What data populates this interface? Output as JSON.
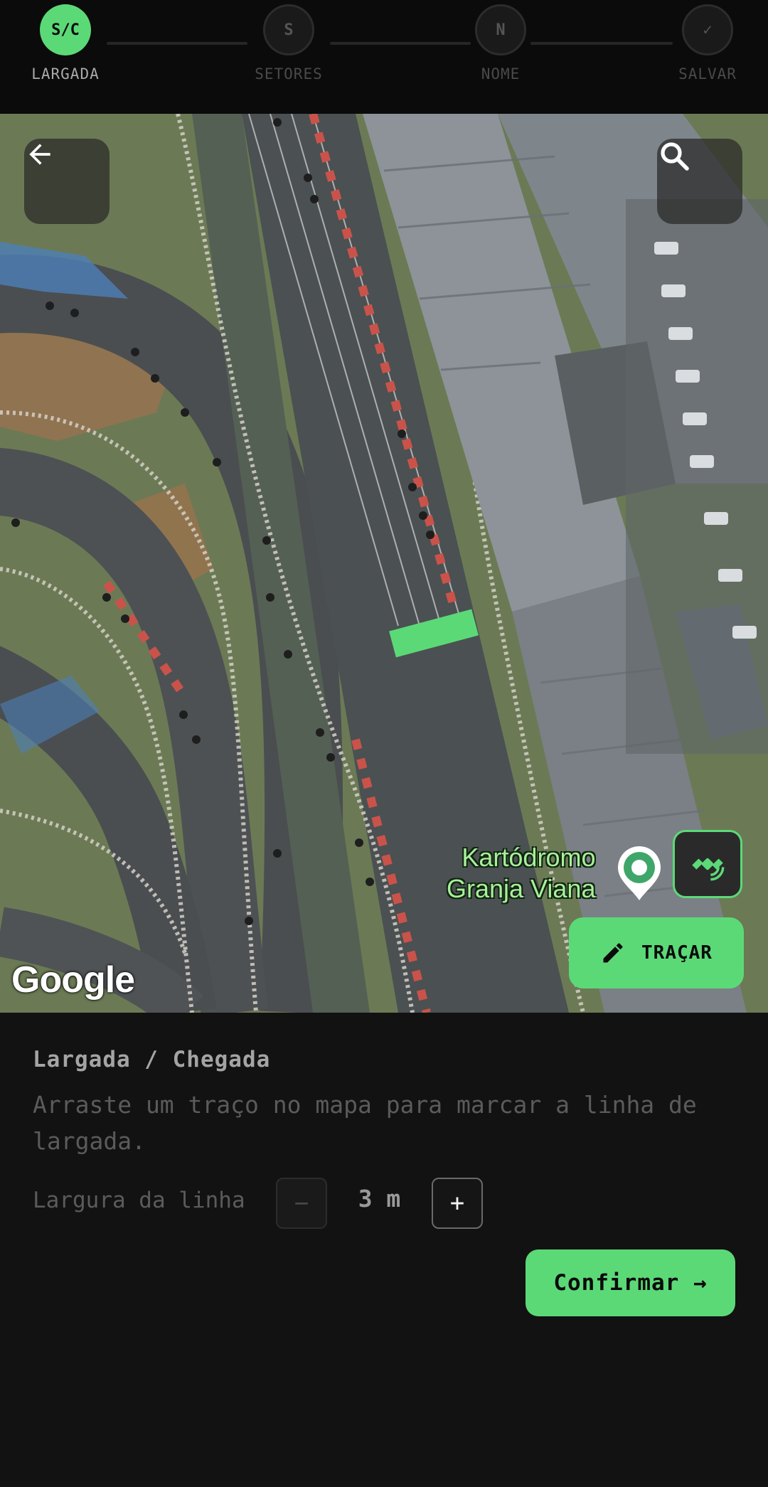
{
  "stepper": {
    "steps": [
      {
        "code": "S/C",
        "label": "LARGADA",
        "state": "active"
      },
      {
        "code": "S",
        "label": "SETORES",
        "state": "pending"
      },
      {
        "code": "N",
        "label": "NOME",
        "state": "pending"
      },
      {
        "code": "✓",
        "label": "SALVAR",
        "state": "pending"
      }
    ]
  },
  "map": {
    "back_icon": "arrow-left-icon",
    "search_icon": "search-icon",
    "place_name_line1": "Kartódromo",
    "place_name_line2": "Granja Viana",
    "pin_icon": "map-pin-icon",
    "satellite_icon": "satellite-icon",
    "draw_button": {
      "icon": "pencil-icon",
      "label": "TRAÇAR"
    },
    "attribution": "Google",
    "line_color": "#5cd977"
  },
  "panel": {
    "title": "Largada / Chegada",
    "description": "Arraste um traço no mapa para marcar a linha de largada.",
    "width_label": "Largura da linha",
    "decrement_label": "−",
    "width_value": "3 m",
    "increment_label": "+",
    "confirm_label": "Confirmar →"
  },
  "colors": {
    "accent": "#5cd977",
    "background": "#121212",
    "header": "#0b0b0b"
  }
}
